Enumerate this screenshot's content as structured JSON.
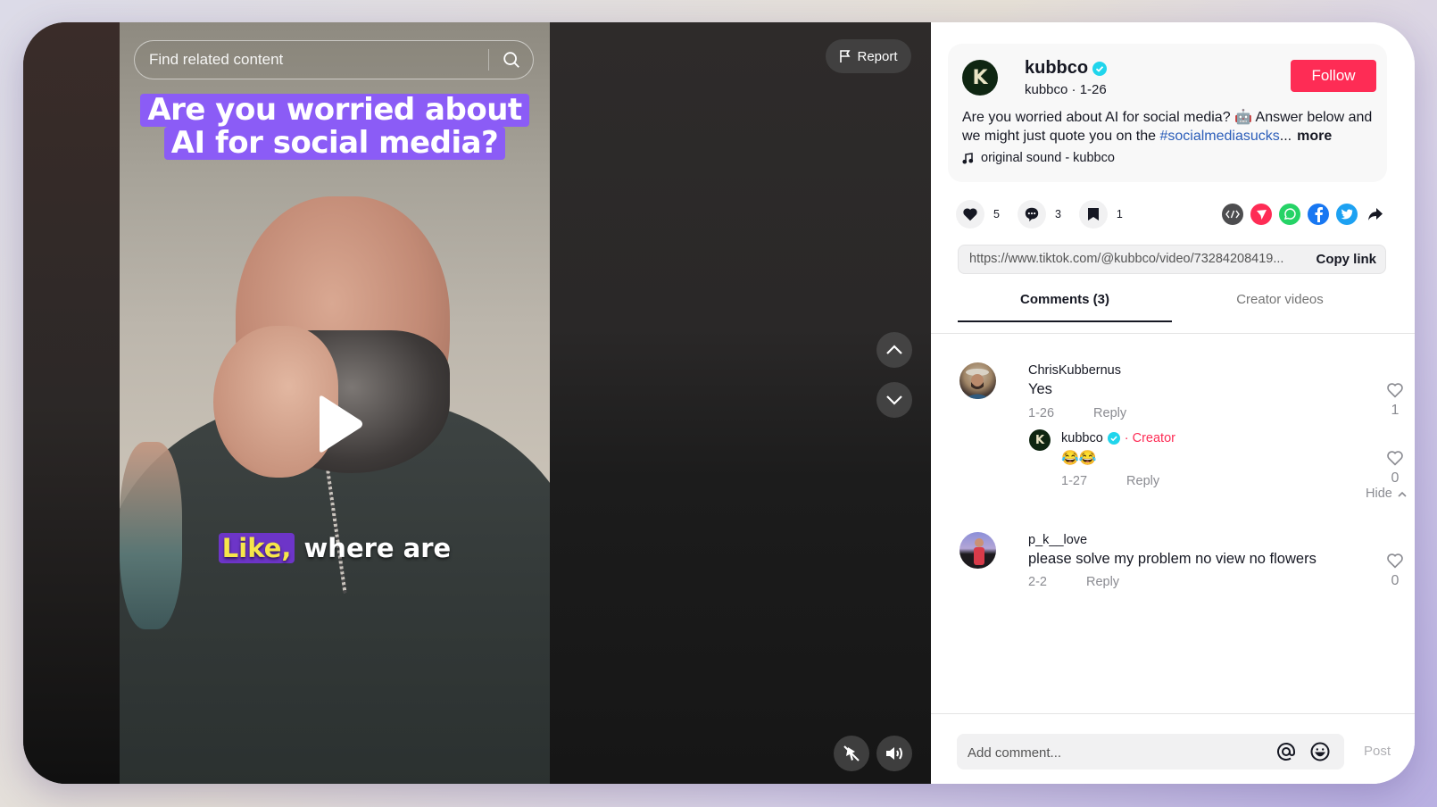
{
  "video": {
    "search_placeholder": "Find related content",
    "overlay_title_line1": "Are you worried about",
    "overlay_title_line2": "AI for social media?",
    "caption_highlight": "Like,",
    "caption_rest": " where are",
    "report_label": "Report",
    "icons": {
      "search": "search-icon",
      "play": "play-icon",
      "report": "flag-icon",
      "prev": "chevron-up-icon",
      "next": "chevron-down-icon",
      "float": "picture-in-picture-off-icon",
      "volume": "volume-icon"
    }
  },
  "post": {
    "username": "kubbco",
    "avatar_letter": "K",
    "verified": true,
    "sub": "kubbco · 1-26",
    "follow_label": "Follow",
    "description_text": "Are you worried about AI for social media? 🤖 Answer below and we might just quote you on the ",
    "hashtag": "#socialmediasucks",
    "ellipsis": "...",
    "more_label": "more",
    "sound": "original sound - kubbco"
  },
  "actions": {
    "likes": "5",
    "comments": "3",
    "saves": "1"
  },
  "share": {
    "items": [
      "embed",
      "send-to-friends",
      "whatsapp",
      "facebook",
      "twitter",
      "share-more"
    ],
    "colors": {
      "embed": "#4d4d4f",
      "send": "#fe2c55",
      "whatsapp": "#25d366",
      "facebook": "#1877f2",
      "twitter": "#1da1f2",
      "brand": "#fe2c55",
      "hashtag": "#2b5db9"
    }
  },
  "link": {
    "url": "https://www.tiktok.com/@kubbco/video/73284208419...",
    "copy_label": "Copy link"
  },
  "tabs": [
    {
      "label": "Comments (3)",
      "active": true
    },
    {
      "label": "Creator videos",
      "active": false
    }
  ],
  "comments": [
    {
      "user": "ChrisKubbernus",
      "text": "Yes",
      "date": "1-26",
      "reply_label": "Reply",
      "likes": "1",
      "replies": [
        {
          "user": "kubbco",
          "avatar_letter": "K",
          "verified": true,
          "badge": "· Creator",
          "text": "😂😂",
          "date": "1-27",
          "reply_label": "Reply",
          "likes": "0"
        }
      ],
      "hide_label": "Hide"
    },
    {
      "user": "p_k__love",
      "text": "please solve my problem no view no flowers",
      "date": "2-2",
      "reply_label": "Reply",
      "likes": "0"
    }
  ],
  "composer": {
    "placeholder": "Add comment...",
    "post_label": "Post"
  }
}
